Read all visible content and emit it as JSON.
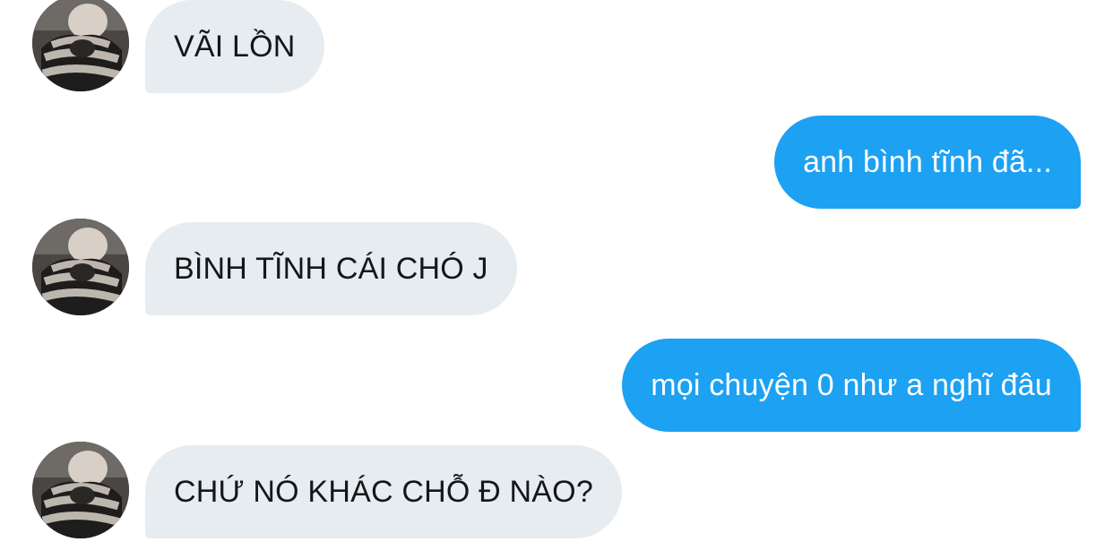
{
  "conversation": {
    "messages": [
      {
        "sender": "them",
        "text": "VÃI LỒN"
      },
      {
        "sender": "me",
        "text": "anh bình tĩnh đã..."
      },
      {
        "sender": "them",
        "text": "BÌNH TĨNH CÁI CHÓ J"
      },
      {
        "sender": "me",
        "text": "mọi chuyện 0 như a nghĩ đâu"
      },
      {
        "sender": "them",
        "text": "CHỨ NÓ KHÁC CHỖ Đ NÀO?"
      }
    ]
  },
  "colors": {
    "incoming_bubble": "#e6ecf0",
    "incoming_text": "#14171a",
    "outgoing_bubble": "#1da1f2",
    "outgoing_text": "#ffffff"
  },
  "icons": {
    "contact_avatar": "avatar-photo-person-striped-sweater"
  }
}
